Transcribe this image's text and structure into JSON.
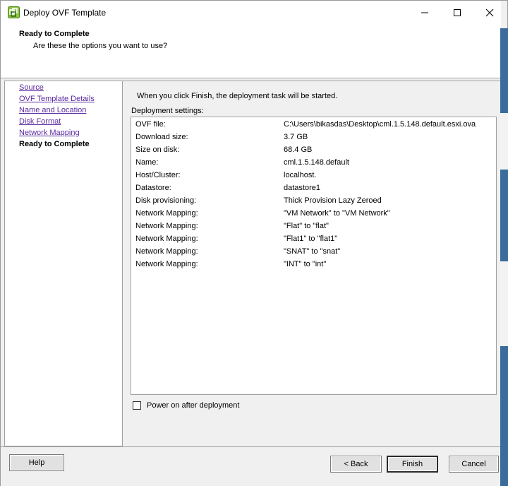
{
  "window": {
    "title": "Deploy OVF Template",
    "icon": "vsphere-logo-icon",
    "controls": [
      "minimize-icon",
      "maximize-icon",
      "close-icon"
    ]
  },
  "header": {
    "title": "Ready to Complete",
    "subtitle": "Are these the options you want to use?"
  },
  "nav": {
    "items": [
      {
        "label": "Source"
      },
      {
        "label": "OVF Template Details"
      },
      {
        "label": "Name and Location"
      },
      {
        "label": "Disk Format"
      },
      {
        "label": "Network Mapping"
      },
      {
        "label": "Ready to Complete"
      }
    ]
  },
  "content": {
    "intro": "When you click Finish, the deployment task will be started.",
    "settings_label": "Deployment settings:",
    "settings": [
      {
        "key": "OVF file:",
        "value": "C:\\Users\\bikasdas\\Desktop\\cml.1.5.148.default.esxi.ova"
      },
      {
        "key": "Download size:",
        "value": "3.7 GB"
      },
      {
        "key": "Size on disk:",
        "value": "68.4 GB"
      },
      {
        "key": "Name:",
        "value": "cml.1.5.148.default"
      },
      {
        "key": "Host/Cluster:",
        "value": "localhost."
      },
      {
        "key": "Datastore:",
        "value": "datastore1"
      },
      {
        "key": "Disk provisioning:",
        "value": "Thick Provision Lazy Zeroed"
      },
      {
        "key": "Network Mapping:",
        "value": "\"VM Network\" to \"VM Network\""
      },
      {
        "key": "Network Mapping:",
        "value": "\"Flat\" to \"flat\""
      },
      {
        "key": "Network Mapping:",
        "value": "\"Flat1\" to \"flat1\""
      },
      {
        "key": "Network Mapping:",
        "value": "\"SNAT\" to \"snat\""
      },
      {
        "key": "Network Mapping:",
        "value": "\"INT\" to \"int\""
      }
    ],
    "power_on_label": "Power on after deployment",
    "power_on_checked": false
  },
  "footer": {
    "help_label": "Help",
    "back_label": "< Back",
    "finish_label": "Finish",
    "cancel_label": "Cancel"
  },
  "colors": {
    "link": "#5a2aa0",
    "dialog_bg": "#f0f0f0",
    "desktop_accent": "#3b6c9c"
  }
}
